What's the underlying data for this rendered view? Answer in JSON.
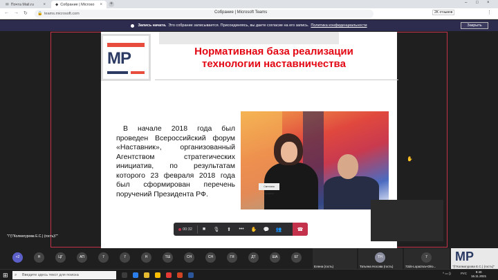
{
  "browser": {
    "tabs": [
      {
        "label": "Почта Mail.ru",
        "active": false
      },
      {
        "label": "Собрание | Microso",
        "active": true
      }
    ],
    "new_tab": "+",
    "url": "teams.microsoft.com",
    "window_title": "Собрание | Microsoft Teams",
    "badge": "2K отзывов",
    "menu": "⋮"
  },
  "banner": {
    "rec_label": "Запись начата.",
    "message": "Это собрание записывается. Присоединяясь, вы даете согласие на его запись.",
    "link": "Политика конфиденциальности",
    "close_label": "Закрыть"
  },
  "slide": {
    "logo_text": "МР",
    "title": "Нормативная база реализации технологии наставничества",
    "body": "В начале 2018 года был проведен Всероссийский форум «Наставник», организованный Агентством стратегических инициатив, по результатам которого 23 февраля 2018 года был сформирован перечень поручений Президента РФ.",
    "photo_plate": "Светлана Чупшева"
  },
  "presenter_label": "\"\\\"(\\\"Колмогурова Е.С.) (гость)\\\"\"",
  "meeting_controls": {
    "timer": "00:32",
    "icons": [
      "camera-icon",
      "mic-off-icon",
      "share-icon",
      "more-icon",
      "raise-hand-icon",
      "chat-icon",
      "participants-icon",
      "hangup-icon"
    ]
  },
  "participants": [
    {
      "initials": "+2",
      "color": "#5b5fc7"
    },
    {
      "initials": "Н",
      "color": "#3a3a3a"
    },
    {
      "initials": "ЦГ",
      "color": "#3a3a3a"
    },
    {
      "initials": "АП",
      "color": "#3a3a3a"
    },
    {
      "initials": "7",
      "color": "#3a3a3a"
    },
    {
      "initials": "7",
      "color": "#3a3a3a"
    },
    {
      "initials": "Н",
      "color": "#3a3a3a"
    },
    {
      "initials": "ТШ",
      "color": "#3a3a3a"
    },
    {
      "initials": "СН",
      "color": "#3a3a3a"
    },
    {
      "initials": "СН",
      "color": "#3a3a3a"
    },
    {
      "initials": "ГЯ",
      "color": "#3a3a3a"
    },
    {
      "initials": "ДТ",
      "color": "#3a3a3a"
    },
    {
      "initials": "ША",
      "color": "#3a3a3a"
    },
    {
      "initials": "ЕГ",
      "color": "#3a3a3a"
    }
  ],
  "video_tiles": [
    {
      "label": "Елена (гость)"
    },
    {
      "initials": "ТН",
      "label": "Татьяна Носова (гость)"
    },
    {
      "initials": "7",
      "label": "72ds-Lopaznov-Dlro..."
    },
    {
      "label": "\"(\\\"Колмогурова Е.С.) (гость)\"",
      "logo": "МР"
    }
  ],
  "taskbar": {
    "search_placeholder": "Введите здесь текст для поиска",
    "lang": "РУС",
    "time": "9:40",
    "date": "16.11.2021"
  },
  "colors": {
    "banner_bg": "#2d2c4e",
    "accent_red": "#c4314b",
    "title_red": "#e30613"
  }
}
